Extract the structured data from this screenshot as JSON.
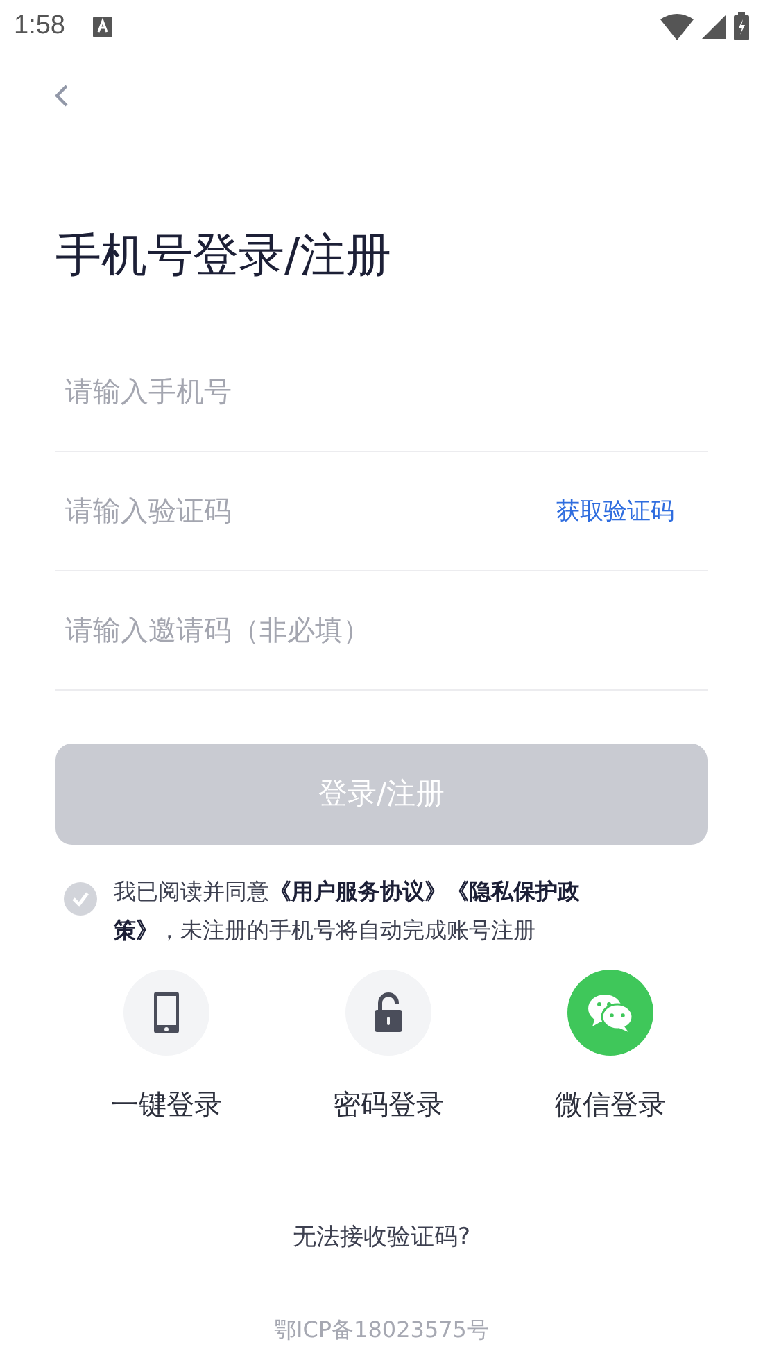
{
  "status_bar": {
    "time": "1:58"
  },
  "title": "手机号登录/注册",
  "fields": [
    {
      "placeholder": "请输入手机号"
    },
    {
      "placeholder": "请输入验证码",
      "action": "获取验证码"
    },
    {
      "placeholder": "请输入邀请码（非必填）"
    }
  ],
  "submit": {
    "label": "登录/注册",
    "disabled": true
  },
  "agreement": {
    "checked": false,
    "text": "我已阅读并同意**《用户服务协议》《隐私保护政策》**，未注册的手机号将自动完成账号注册"
  },
  "login_options": [
    {
      "kind": "phone",
      "label": "一键登录"
    },
    {
      "kind": "lock",
      "label": "密码登录"
    },
    {
      "kind": "wechat",
      "label": "微信登录"
    }
  ],
  "help_link": "无法接收验证码?",
  "footer": "鄂ICP备18023575号"
}
